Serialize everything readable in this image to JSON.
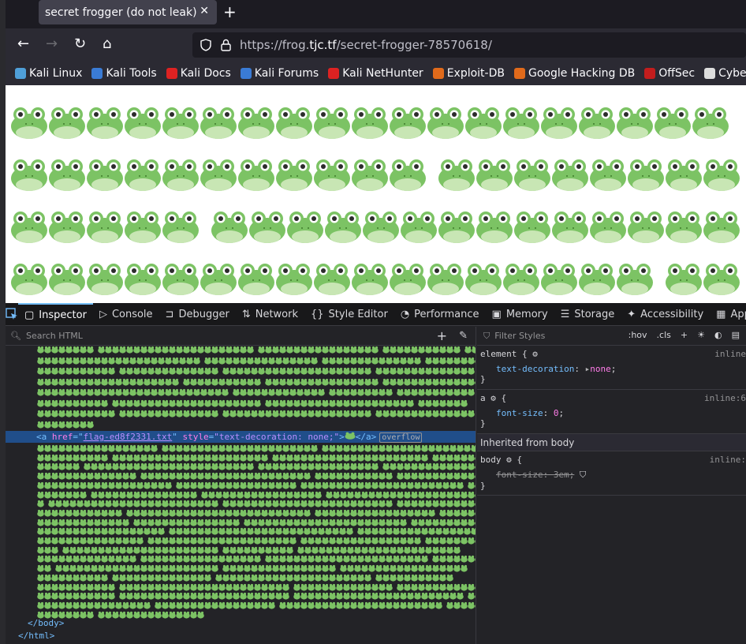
{
  "browser": {
    "tab_title": "secret frogger (do not leak)",
    "tab_close": "✕",
    "new_tab": "+",
    "url_prefix": "https://frog.",
    "url_domain": "tjc.tf",
    "url_path": "/secret-frogger-78570618/"
  },
  "bookmarks": [
    {
      "label": "Kali Linux",
      "color": "#4f9fd8"
    },
    {
      "label": "Kali Tools",
      "color": "#3a7bd5"
    },
    {
      "label": "Kali Docs",
      "color": "#d22"
    },
    {
      "label": "Kali Forums",
      "color": "#3a7bd5"
    },
    {
      "label": "Kali NetHunter",
      "color": "#d22"
    },
    {
      "label": "Exploit-DB",
      "color": "#e06a1b"
    },
    {
      "label": "Google Hacking DB",
      "color": "#e06a1b"
    },
    {
      "label": "OffSec",
      "color": "#c21d1d"
    },
    {
      "label": "CyberCh",
      "color": "#ddd"
    }
  ],
  "devtools": {
    "tabs": [
      "Inspector",
      "Console",
      "Debugger",
      "Network",
      "Style Editor",
      "Performance",
      "Memory",
      "Storage",
      "Accessibility",
      "Application"
    ],
    "search_placeholder": "Search HTML",
    "selected_node": {
      "open": "<a ",
      "attr_href": "href",
      "href_value": "flag-ed8f2331.txt",
      "attr_style": "style",
      "style_value": "\"text-decoration: none;\"",
      "close": "</a>",
      "badge": "overflow"
    },
    "closing_body": "</body>",
    "closing_html": "</html>",
    "styles": {
      "filter_placeholder": "Filter Styles",
      "hov": ":hov",
      "cls": ".cls",
      "rule1_selector": "element {",
      "rule1_source": "inline",
      "rule1_prop": "text-decoration",
      "rule1_value": "none",
      "rule2_selector": "a",
      "rule2_source": "inline:6",
      "rule2_prop": "font-size",
      "rule2_value": "0",
      "inherited_label": "Inherited from body",
      "rule3_selector": "body",
      "rule3_source": "inline:",
      "rule3_prop": "font-size",
      "rule3_value": "3em",
      "close_brace": "}"
    }
  },
  "colors": {
    "accent": "#75bfff",
    "selection": "#204e8a",
    "frog_green": "#7cc364"
  }
}
